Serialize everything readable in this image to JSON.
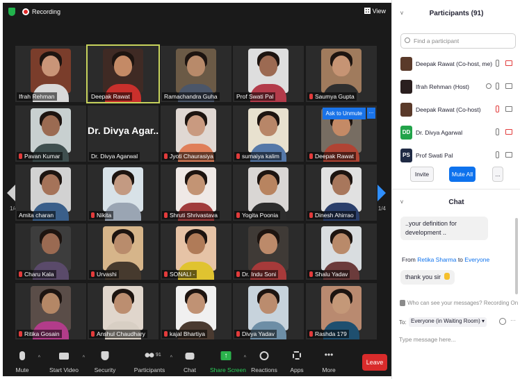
{
  "topbar": {
    "recording_label": "Recording",
    "view_label": "View"
  },
  "tiles": [
    {
      "name": "Ifrah Rehman",
      "muted": false,
      "bg": "#7a3d2b",
      "skin": "#c99578",
      "shirt": "#d9d9d9"
    },
    {
      "name": "Deepak Rawat",
      "muted": false,
      "bg": "#3f2a24",
      "skin": "#c48a66",
      "shirt": "#c9302c",
      "speaking": true
    },
    {
      "name": "Ramachandra Guha",
      "muted": false,
      "bg": "#6b5a46",
      "skin": "#b88a6a",
      "shirt": "#4b5669"
    },
    {
      "name": "Prof Swati Pal",
      "muted": false,
      "bg": "#dedede",
      "skin": "#9c6a52",
      "shirt": "#b33b4a"
    },
    {
      "name": "Saumya Gupta",
      "muted": true,
      "bg": "#a07b5d",
      "skin": "#c69474",
      "shirt": "#2f2f2f"
    },
    {
      "name": "Pavan Kumar",
      "muted": true,
      "bg": "#c8d0d0",
      "skin": "#9b6b52",
      "shirt": "#3f4f4f"
    },
    {
      "name": "Dr. Divya Agarwal",
      "muted": false,
      "big": "Dr. Divya Agar..."
    },
    {
      "name": "Jyoti Chaurasiya",
      "muted": true,
      "bg": "#e0d8d3",
      "skin": "#c99a80",
      "shirt": "#e07f5a"
    },
    {
      "name": "sumaiya kalim",
      "muted": true,
      "bg": "#e8e1cf",
      "skin": "#b88668",
      "shirt": "#5578a8"
    },
    {
      "name": "Deepak Rawat",
      "muted": true,
      "bg": "#776d62",
      "skin": "#c48a66",
      "shirt": "#b04434"
    },
    {
      "name": "Amita charan",
      "muted": false,
      "bg": "#d2d2d2",
      "skin": "#a57359",
      "shirt": "#3a5f8a"
    },
    {
      "name": "Nikita",
      "muted": true,
      "bg": "#d8e2e8",
      "skin": "#c39a82",
      "shirt": "#9aa5b3"
    },
    {
      "name": "Shruti Shrivastava",
      "muted": true,
      "bg": "#efe9e6",
      "skin": "#c39474",
      "shirt": "#a13c3c"
    },
    {
      "name": "Yogita Poonia",
      "muted": true,
      "bg": "#d9d6d4",
      "skin": "#b88460",
      "shirt": "#2d2d2d"
    },
    {
      "name": "Dinesh Ahirrao",
      "muted": true,
      "bg": "#e1e1e1",
      "skin": "#a8775c",
      "shirt": "#2b3f6b"
    },
    {
      "name": "Charu Kala",
      "muted": true,
      "bg": "#3d3d3d",
      "skin": "#9a6a52",
      "shirt": "#5a4a6a"
    },
    {
      "name": "Urvashi",
      "muted": true,
      "bg": "#d6b58a",
      "skin": "#b98c6c",
      "shirt": "#463a2e"
    },
    {
      "name": "SONALI -",
      "muted": true,
      "bg": "#e6c3a6",
      "skin": "#b07b58",
      "shirt": "#e0c330"
    },
    {
      "name": "Dr. Indu Soni",
      "muted": true,
      "bg": "#3f3a36",
      "skin": "#bc8a6a",
      "shirt": "#a63a3a"
    },
    {
      "name": "Shalu Yadav",
      "muted": true,
      "bg": "#d9dde0",
      "skin": "#b98a6a",
      "shirt": "#6b3b3b"
    },
    {
      "name": "Ritika Gosain",
      "muted": true,
      "bg": "#5a4d48",
      "skin": "#b48766",
      "shirt": "#b23c8a"
    },
    {
      "name": "Anshul Chaudhary",
      "muted": true,
      "bg": "#e0d6cc",
      "skin": "#bc8e70",
      "shirt": "#d8cfc4"
    },
    {
      "name": "kajal Bhartiya",
      "muted": true,
      "bg": "#f0f0f0",
      "skin": "#c09274",
      "shirt": "#4a3a30"
    },
    {
      "name": "Divya Yadav",
      "muted": true,
      "bg": "#c7d3dc",
      "skin": "#bb8c6e",
      "shirt": "#6d8ea6"
    },
    {
      "name": "Rashda 179",
      "muted": true,
      "bg": "#b98a70",
      "skin": "#c49878",
      "shirt": "#1f4f6f"
    }
  ],
  "ask_to_unmute": "Ask to Unmute",
  "more_dots": "...",
  "pages": {
    "left": "1/4",
    "right": "1/4"
  },
  "toolbar": {
    "mute": "Mute",
    "start_video": "Start Video",
    "security": "Security",
    "participants": "Participants",
    "participants_count": "91",
    "chat": "Chat",
    "share_screen": "Share Screen",
    "reactions": "Reactions",
    "apps": "Apps",
    "more": "More",
    "leave": "Leave",
    "more_icon": "•••"
  },
  "participants_panel": {
    "title": "Participants (91)",
    "search_placeholder": "Find a participant",
    "list": [
      {
        "name": "Deepak Rawat (Co-host, me)",
        "avatar_color": "#5a3a2a",
        "initials": "",
        "mic_off": false,
        "video_off": true
      },
      {
        "name": "Ifrah Rehman (Host)",
        "avatar_color": "#2a1f1f",
        "initials": "",
        "mic_off": false,
        "video_off": false,
        "recording": true
      },
      {
        "name": "Deepak Rawat (Co-host)",
        "avatar_color": "#5a3a2a",
        "initials": "",
        "mic_off": true,
        "video_off": false
      },
      {
        "name": "Dr. Divya Agarwal",
        "avatar_color": "#22a34a",
        "initials": "DD",
        "mic_off": false,
        "video_off": true
      },
      {
        "name": "Prof Swati Pal",
        "avatar_color": "#1f2a44",
        "initials": "PS",
        "mic_off": false,
        "video_off": false
      }
    ],
    "invite_label": "Invite",
    "mute_all_label": "Mute All",
    "more_label": "..."
  },
  "chat_panel": {
    "title": "Chat",
    "message_prev": "..your definition for development ..",
    "from_prefix": "From",
    "from_name": "Retika Sharma",
    "to_word": "to",
    "to_name": "Everyone",
    "message": "thank you sir",
    "who_can_see": "Who can see your messages? Recording On",
    "to_label": "To:",
    "to_value": "Everyone (in Waiting Room)",
    "input_placeholder": "Type message here..."
  }
}
